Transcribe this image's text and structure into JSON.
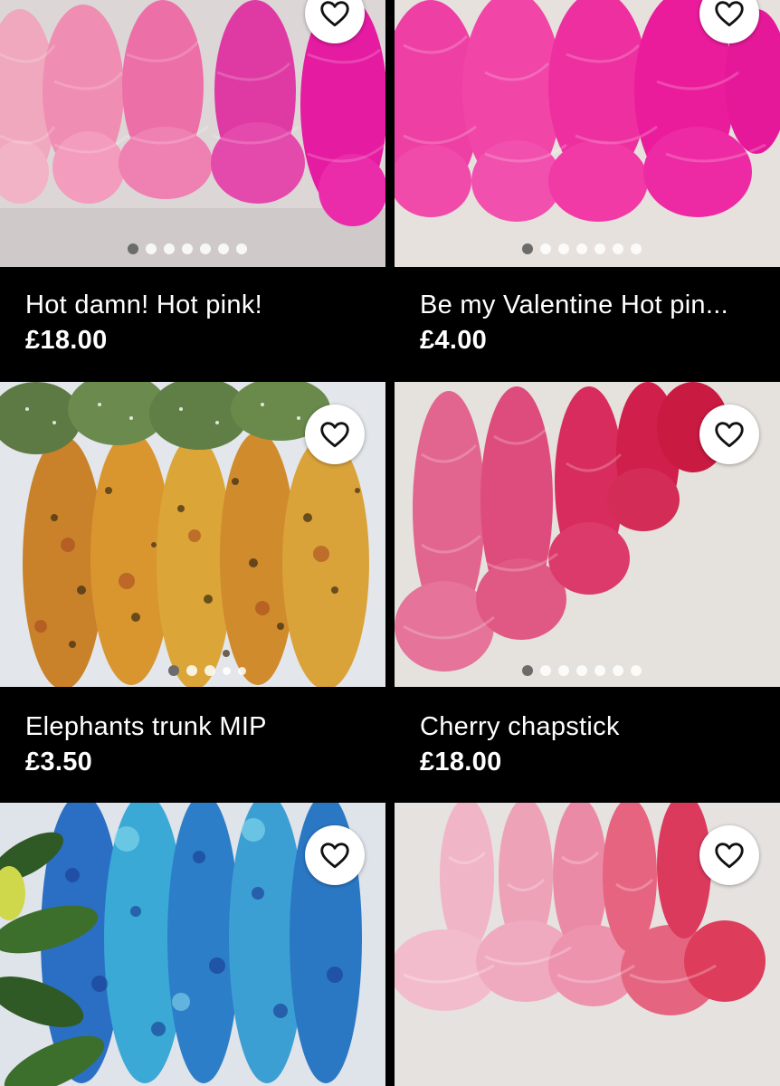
{
  "listings": [
    {
      "title": "Hot damn! Hot pink!",
      "price": "£18.00",
      "favorite_icon": "heart-outline-icon",
      "carousel": {
        "count": 7,
        "active": 0
      }
    },
    {
      "title": "Be my Valentine Hot pin...",
      "price": "£4.00",
      "favorite_icon": "heart-outline-icon",
      "carousel": {
        "count": 7,
        "active": 0
      }
    },
    {
      "title": "Elephants trunk MIP",
      "price": "£3.50",
      "favorite_icon": "heart-outline-icon",
      "carousel": {
        "count": 5,
        "active": 0
      }
    },
    {
      "title": "Cherry chapstick",
      "price": "£18.00",
      "favorite_icon": "heart-outline-icon",
      "carousel": {
        "count": 7,
        "active": 0
      }
    },
    {
      "title": "",
      "price": "",
      "favorite_icon": "heart-outline-icon",
      "carousel": {
        "count": 0,
        "active": 0
      }
    },
    {
      "title": "",
      "price": "",
      "favorite_icon": "heart-outline-icon",
      "carousel": {
        "count": 0,
        "active": 0
      }
    }
  ],
  "colors": {
    "background": "#000000",
    "text": "#ffffff",
    "dot_active": "#6b6b6b",
    "dot_inactive": "#ffffff"
  }
}
